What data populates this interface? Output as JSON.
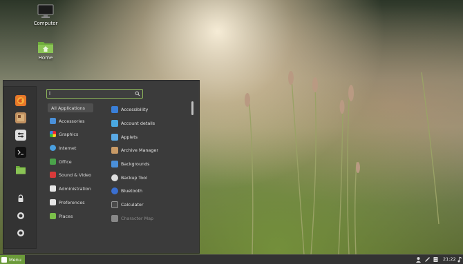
{
  "desktop": {
    "icons": [
      {
        "label": "Computer",
        "icon": "monitor-icon"
      },
      {
        "label": "Home",
        "icon": "home-folder-icon"
      }
    ]
  },
  "menu": {
    "search": {
      "value": "l",
      "placeholder": ""
    },
    "favorites": [
      {
        "name": "firefox-icon",
        "color": "#e8782a"
      },
      {
        "name": "software-manager-icon",
        "color": "#c09060"
      },
      {
        "name": "system-settings-icon",
        "color": "#e0e0e0"
      },
      {
        "name": "terminal-icon",
        "color": "#111111"
      },
      {
        "name": "files-icon",
        "color": "#6fae3c"
      },
      {
        "name": "lock-screen-icon",
        "color": "#dddddd"
      },
      {
        "name": "logout-icon",
        "color": "#dddddd"
      },
      {
        "name": "power-icon",
        "color": "#dddddd"
      }
    ],
    "categories": [
      {
        "label": "All Applications",
        "icon": "",
        "color": ""
      },
      {
        "label": "Accessories",
        "icon": "accessories-icon",
        "color": "#4a90d9"
      },
      {
        "label": "Graphics",
        "icon": "graphics-icon",
        "color": "#d04a9a"
      },
      {
        "label": "Internet",
        "icon": "internet-icon",
        "color": "#4aa0e0"
      },
      {
        "label": "Office",
        "icon": "office-icon",
        "color": "#4aa34a"
      },
      {
        "label": "Sound & Video",
        "icon": "sound-video-icon",
        "color": "#d83a3a"
      },
      {
        "label": "Administration",
        "icon": "administration-icon",
        "color": "#e6e6e6"
      },
      {
        "label": "Preferences",
        "icon": "preferences-icon",
        "color": "#e6e6e6"
      },
      {
        "label": "Places",
        "icon": "places-folder-icon",
        "color": "#7bbf4a"
      }
    ],
    "apps": [
      {
        "label": "Accessibility",
        "icon": "accessibility-icon",
        "color": "#3a7fd8"
      },
      {
        "label": "Account details",
        "icon": "account-details-icon",
        "color": "#4aa8e0"
      },
      {
        "label": "Applets",
        "icon": "applets-icon",
        "color": "#5aaae6"
      },
      {
        "label": "Archive Manager",
        "icon": "archive-manager-icon",
        "color": "#c89a66"
      },
      {
        "label": "Backgrounds",
        "icon": "backgrounds-icon",
        "color": "#4a8fd9"
      },
      {
        "label": "Backup Tool",
        "icon": "backup-tool-icon",
        "color": "#dddddd"
      },
      {
        "label": "Bluetooth",
        "icon": "bluetooth-icon",
        "color": "#3a6fd0"
      },
      {
        "label": "Calculator",
        "icon": "calculator-icon",
        "color": "#4a4a4a"
      },
      {
        "label": "Character Map",
        "icon": "character-map-icon",
        "color": "#888888"
      }
    ]
  },
  "taskbar": {
    "menu_label": "Menu",
    "clock": "21:22",
    "tray_icons": [
      "user-icon",
      "pen-icon",
      "document-icon",
      "sound-icon"
    ]
  }
}
